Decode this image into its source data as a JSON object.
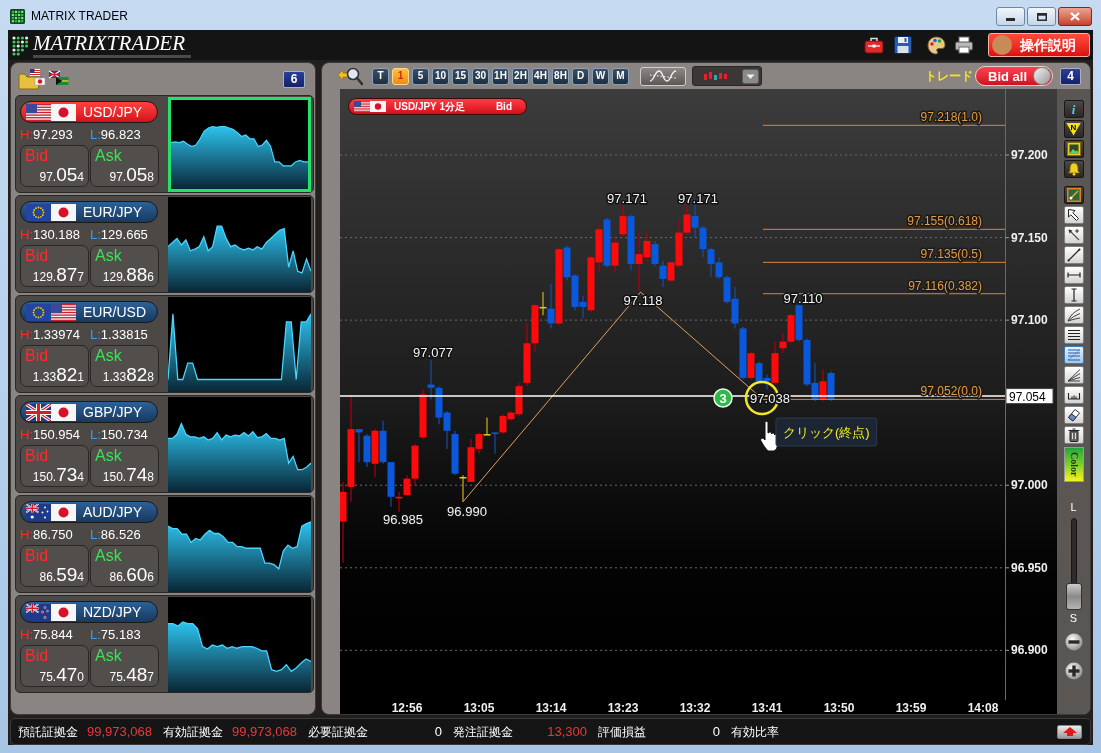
{
  "window": {
    "title": "MATRIX TRADER"
  },
  "header": {
    "logo": "MATRIXTRADER",
    "help_button": "操作説明"
  },
  "rates_panel": {
    "count": "6",
    "pairs": [
      {
        "flags": [
          {
            "kind": "us"
          },
          {
            "kind": "jp"
          }
        ],
        "name": "USD/JPY",
        "selected": true,
        "high_label": "H:",
        "high": "97.293",
        "low_label": "L:",
        "low": "96.823",
        "bid_label": "Bid",
        "bid": {
          "head": "97.",
          "big": "05",
          "tail": "4"
        },
        "ask_label": "Ask",
        "ask": {
          "head": "97.",
          "big": "05",
          "tail": "8"
        }
      },
      {
        "flags": [
          {
            "kind": "eu"
          },
          {
            "kind": "jp"
          }
        ],
        "name": "EUR/JPY",
        "selected": false,
        "high_label": "H:",
        "high": "130.188",
        "low_label": "L:",
        "low": "129.665",
        "bid_label": "Bid",
        "bid": {
          "head": "129.",
          "big": "87",
          "tail": "7"
        },
        "ask_label": "Ask",
        "ask": {
          "head": "129.",
          "big": "88",
          "tail": "6"
        }
      },
      {
        "flags": [
          {
            "kind": "eu"
          },
          {
            "kind": "us"
          }
        ],
        "name": "EUR/USD",
        "selected": false,
        "high_label": "H:",
        "high": "1.33974",
        "low_label": "L:",
        "low": "1.33815",
        "bid_label": "Bid",
        "bid": {
          "head": "1.33",
          "big": "82",
          "tail": "1"
        },
        "ask_label": "Ask",
        "ask": {
          "head": "1.33",
          "big": "82",
          "tail": "8"
        }
      },
      {
        "flags": [
          {
            "kind": "gb"
          },
          {
            "kind": "jp"
          }
        ],
        "name": "GBP/JPY",
        "selected": false,
        "high_label": "H:",
        "high": "150.954",
        "low_label": "L:",
        "low": "150.734",
        "bid_label": "Bid",
        "bid": {
          "head": "150.",
          "big": "73",
          "tail": "4"
        },
        "ask_label": "Ask",
        "ask": {
          "head": "150.",
          "big": "74",
          "tail": "8"
        }
      },
      {
        "flags": [
          {
            "kind": "au"
          },
          {
            "kind": "jp"
          }
        ],
        "name": "AUD/JPY",
        "selected": false,
        "high_label": "H:",
        "high": "86.750",
        "low_label": "L:",
        "low": "86.526",
        "bid_label": "Bid",
        "bid": {
          "head": "86.",
          "big": "59",
          "tail": "4"
        },
        "ask_label": "Ask",
        "ask": {
          "head": "86.",
          "big": "60",
          "tail": "6"
        }
      },
      {
        "flags": [
          {
            "kind": "nz"
          },
          {
            "kind": "jp"
          }
        ],
        "name": "NZD/JPY",
        "selected": false,
        "high_label": "H:",
        "high": "75.844",
        "low_label": "L:",
        "low": "75.183",
        "bid_label": "Bid",
        "bid": {
          "head": "75.",
          "big": "47",
          "tail": "0"
        },
        "ask_label": "Ask",
        "ask": {
          "head": "75.",
          "big": "48",
          "tail": "7"
        }
      }
    ]
  },
  "chart_panel": {
    "timeframes": [
      {
        "label": "T",
        "selected": false
      },
      {
        "label": "1",
        "selected": true
      },
      {
        "label": "5",
        "selected": false
      },
      {
        "label": "10",
        "selected": false
      },
      {
        "label": "15",
        "selected": false
      },
      {
        "label": "30",
        "selected": false
      },
      {
        "label": "1H",
        "selected": false
      },
      {
        "label": "2H",
        "selected": false
      },
      {
        "label": "4H",
        "selected": false
      },
      {
        "label": "8H",
        "selected": false
      },
      {
        "label": "D",
        "selected": false
      },
      {
        "label": "W",
        "selected": false
      },
      {
        "label": "M",
        "selected": false
      }
    ],
    "trade_label": "トレード",
    "price_toggle": {
      "label": "Bid all",
      "on": true
    },
    "count": "4",
    "chart": {
      "flags": [
        {
          "kind": "us"
        },
        {
          "kind": "jp"
        }
      ],
      "title": "USD/JPY 1分足",
      "price_type": "Bid",
      "price_axis": [
        "97.200",
        "97.150",
        "97.100",
        "97.000",
        "96.950",
        "96.900"
      ],
      "time_axis": [
        "12:56",
        "13:05",
        "13:14",
        "13:23",
        "13:32",
        "13:41",
        "13:50",
        "13:59",
        "14:08"
      ],
      "fibonacci_levels": [
        "97.218(1.0)",
        "97.155(0.618)",
        "97.135(0.5)",
        "97.116(0.382)",
        "97.052(0.0)"
      ],
      "point_labels": [
        "97.077",
        "96.985",
        "96.990",
        "97.171",
        "97.118",
        "97.171",
        "97.110",
        "97.038"
      ],
      "current_price": "97.054",
      "step_badge": "3",
      "tooltip": "クリック(終点)"
    },
    "info_buttons": [
      {
        "kind": "info",
        "glyph": "i"
      },
      {
        "kind": "news",
        "glyph": "N"
      },
      {
        "kind": "image"
      },
      {
        "kind": "alert"
      }
    ],
    "drawing_tools": [
      {
        "kind": "toolset",
        "selected": false
      },
      {
        "kind": "pointer",
        "selected": false
      },
      {
        "kind": "select",
        "selected": false
      },
      {
        "kind": "line",
        "selected": false
      },
      {
        "kind": "hline",
        "selected": false
      },
      {
        "kind": "vline",
        "selected": false
      },
      {
        "kind": "fan",
        "selected": false
      },
      {
        "kind": "channel",
        "selected": false
      },
      {
        "kind": "fibonacci",
        "selected": true
      },
      {
        "kind": "angle",
        "selected": false
      },
      {
        "kind": "ruler",
        "selected": false
      },
      {
        "kind": "eraser",
        "selected": false
      },
      {
        "kind": "trash",
        "selected": false
      }
    ],
    "color_button": "Color",
    "zoom": {
      "top_label": "L",
      "bottom_label": "S",
      "level": 0
    }
  },
  "status_bar": {
    "items": [
      {
        "label": "預託証拠金",
        "value": "99,973,068",
        "color": "#e8383a"
      },
      {
        "label": "有効証拠金",
        "value": "99,973,068",
        "color": "#e8383a"
      },
      {
        "label": "必要証拠金",
        "value": "0"
      },
      {
        "label": "発注証拠金",
        "value": "13,300",
        "color": "#e8383a"
      },
      {
        "label": "評価損益",
        "value": "0"
      },
      {
        "label": "有効比率"
      }
    ]
  }
}
